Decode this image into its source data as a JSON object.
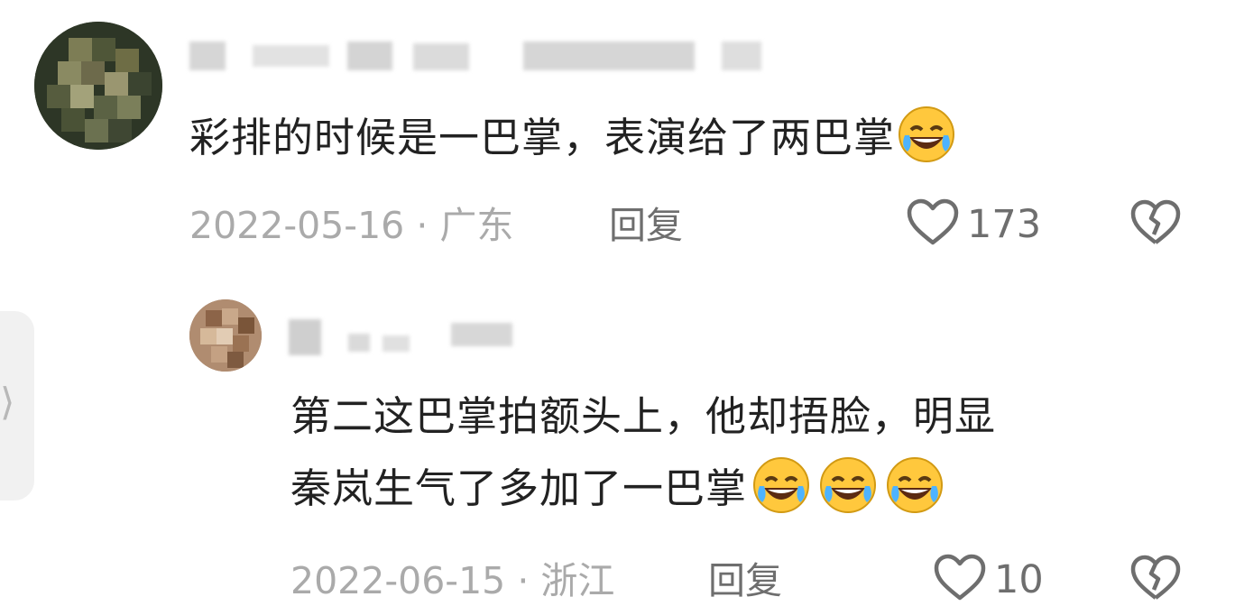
{
  "comments": [
    {
      "text": "彩排的时候是一巴掌，表演给了两巴掌",
      "emoji_count": 1,
      "date": "2022-05-16",
      "location": "广东",
      "meta_separator": "·",
      "reply_label": "回复",
      "likes": "173"
    },
    {
      "text_line1": "第二这巴掌拍额头上，他却捂脸，明显",
      "text_line2": "秦岚生气了多加了一巴掌",
      "emoji_count": 3,
      "date": "2022-06-15",
      "location": "浙江",
      "meta_separator": "·",
      "reply_label": "回复",
      "likes": "10"
    }
  ],
  "icons": {
    "like": "heart-outline-icon",
    "dislike": "broken-heart-icon",
    "emoji": "rolling-on-floor-laughing-emoji",
    "side_handle": "chevron-right-icon"
  },
  "colors": {
    "text": "#222222",
    "meta": "#aaaaaa",
    "action": "#6e6e6e"
  }
}
